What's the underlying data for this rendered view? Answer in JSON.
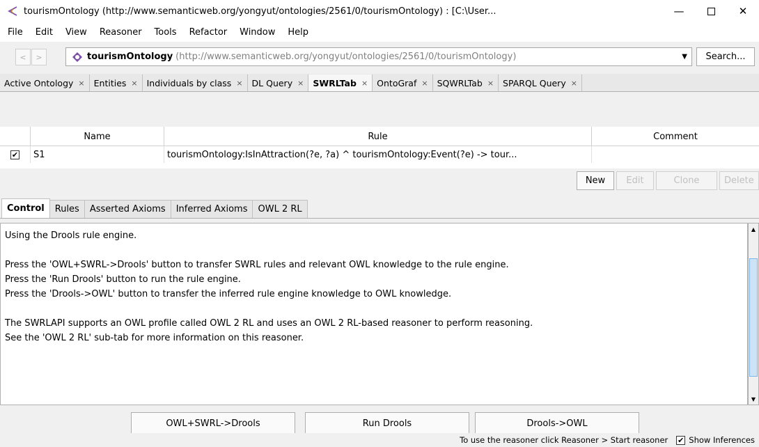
{
  "window": {
    "title": "tourismOntology (http://www.semanticweb.org/yongyut/ontologies/2561/0/tourismOntology) : [C:\\User...",
    "minimize": "—",
    "close": "✕"
  },
  "menu": [
    "File",
    "Edit",
    "View",
    "Reasoner",
    "Tools",
    "Refactor",
    "Window",
    "Help"
  ],
  "address": {
    "back": "<",
    "forward": ">",
    "name": "tourismOntology",
    "uri": "(http://www.semanticweb.org/yongyut/ontologies/2561/0/tourismOntology)",
    "dropdown": "▼",
    "search_label": "Search..."
  },
  "tabs": [
    {
      "label": "Active Ontology",
      "close": "×"
    },
    {
      "label": "Entities",
      "close": "×"
    },
    {
      "label": "Individuals by class",
      "close": "×"
    },
    {
      "label": "DL Query",
      "close": "×"
    },
    {
      "label": "SWRLTab",
      "close": "×"
    },
    {
      "label": "OntoGraf",
      "close": "×"
    },
    {
      "label": "SQWRLTab",
      "close": "×"
    },
    {
      "label": "SPARQL Query",
      "close": "×"
    }
  ],
  "rules_table": {
    "headers": {
      "name": "Name",
      "rule": "Rule",
      "comment": "Comment"
    },
    "rows": [
      {
        "checked": "✔",
        "name": "S1",
        "rule": "tourismOntology:IsInAttraction(?e, ?a) ^ tourismOntology:Event(?e) -> tour...",
        "comment": ""
      }
    ]
  },
  "rule_buttons": {
    "new": "New",
    "edit": "Edit",
    "clone": "Clone",
    "delete": "Delete"
  },
  "subtabs": [
    "Control",
    "Rules",
    "Asserted Axioms",
    "Inferred Axioms",
    "OWL 2 RL"
  ],
  "console": {
    "lines": [
      "Using the Drools rule engine.",
      "",
      "Press the 'OWL+SWRL->Drools' button to transfer SWRL rules and relevant OWL knowledge to the rule engine.",
      "Press the 'Run Drools' button to run the rule engine.",
      "Press the 'Drools->OWL' button to transfer the inferred rule engine knowledge to OWL knowledge.",
      "",
      "The SWRLAPI supports an OWL profile called OWL 2 RL and uses an OWL 2 RL-based reasoner to perform reasoning.",
      "See the 'OWL 2 RL' sub-tab for more information on this reasoner."
    ]
  },
  "actions": {
    "owl_swrl_drools": "OWL+SWRL->Drools",
    "run_drools": "Run Drools",
    "drools_owl": "Drools->OWL"
  },
  "status": {
    "text": "To use the reasoner click Reasoner > Start reasoner",
    "show_inferences_checked": "✔",
    "show_inferences": "Show Inferences"
  },
  "colors": {
    "accent": "#7b4fa8",
    "scroll_thumb": "#cde4f7"
  }
}
